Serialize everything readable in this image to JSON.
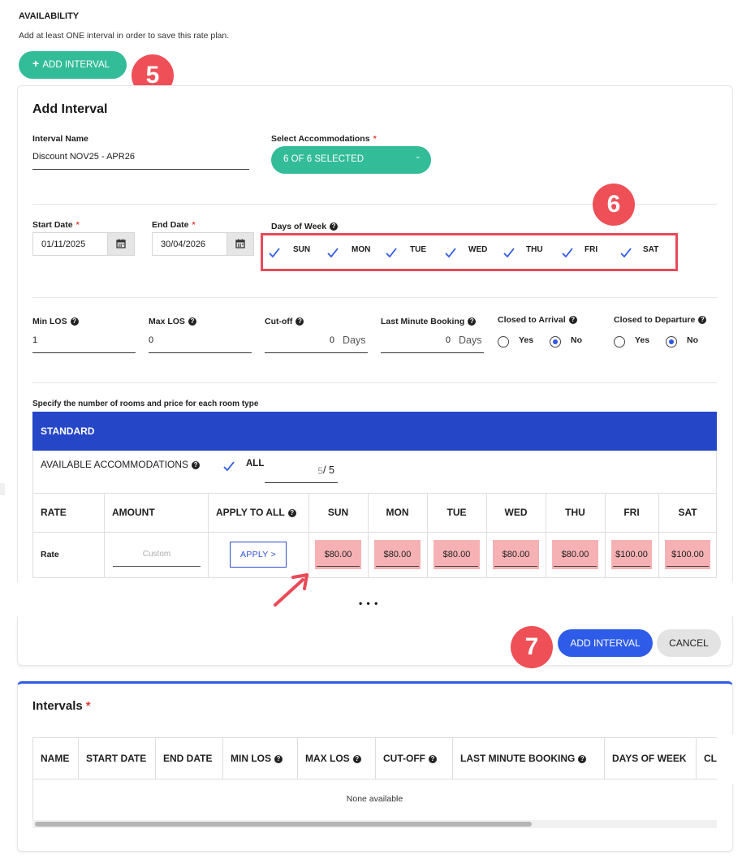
{
  "availability": {
    "heading": "AVAILABILITY",
    "note": "Add at least ONE interval in order to save this rate plan.",
    "add_button": "ADD INTERVAL",
    "add_button_icon": "plus-icon"
  },
  "callouts": {
    "step5": "5",
    "step6": "6",
    "step7": "7"
  },
  "form": {
    "title": "Add Interval",
    "interval_name": {
      "label": "Interval Name",
      "value": "Discount NOV25 - APR26"
    },
    "accommodations": {
      "label": "Select Accommodations",
      "required": "*",
      "value": "6 OF 6 SELECTED"
    },
    "start_date": {
      "label": "Start Date",
      "required": "*",
      "value": "01/11/2025"
    },
    "end_date": {
      "label": "End Date",
      "required": "*",
      "value": "30/04/2026"
    },
    "days_of_week": {
      "label": "Days of Week",
      "days": [
        "SUN",
        "MON",
        "TUE",
        "WED",
        "THU",
        "FRI",
        "SAT"
      ]
    },
    "min_los": {
      "label": "Min LOS",
      "value": "1"
    },
    "max_los": {
      "label": "Max LOS",
      "value": "0"
    },
    "cutoff": {
      "label": "Cut-off",
      "value": "0",
      "unit": "Days"
    },
    "last_minute": {
      "label": "Last Minute Booking",
      "value": "0",
      "unit": "Days"
    },
    "closed_arrival": {
      "label": "Closed to Arrival",
      "yes": "Yes",
      "no": "No",
      "selected": "No"
    },
    "closed_departure": {
      "label": "Closed to Departure",
      "yes": "Yes",
      "no": "No",
      "selected": "No"
    },
    "rooms_note": "Specify the number of rooms and price for each room type",
    "room_type": "STANDARD",
    "available_accommodations": {
      "label": "AVAILABLE ACCOMMODATIONS",
      "all_label": "ALL",
      "count": "5",
      "total": "/ 5"
    },
    "rate_table": {
      "headers": [
        "RATE",
        "AMOUNT",
        "APPLY TO ALL",
        "SUN",
        "MON",
        "TUE",
        "WED",
        "THU",
        "FRI",
        "SAT"
      ],
      "row_label": "Rate",
      "amount_placeholder": "Custom",
      "apply_button": "APPLY >",
      "prices": [
        "$80.00",
        "$80.00",
        "$80.00",
        "$80.00",
        "$80.00",
        "$100.00",
        "$100.00"
      ]
    },
    "ellipsis": "• • •",
    "submit": "ADD INTERVAL",
    "cancel": "CANCEL"
  },
  "intervals": {
    "title": "Intervals",
    "required": "*",
    "headers": [
      "NAME",
      "START DATE",
      "END DATE",
      "MIN LOS",
      "MAX LOS",
      "CUT-OFF",
      "LAST MINUTE BOOKING",
      "DAYS OF WEEK",
      "CL"
    ],
    "empty": "None available"
  },
  "colors": {
    "teal": "#33bc98",
    "blue_header": "#2547c7",
    "primary": "#2e5be8",
    "callout": "#ef4f56",
    "price_highlight": "#f6b1b4"
  }
}
